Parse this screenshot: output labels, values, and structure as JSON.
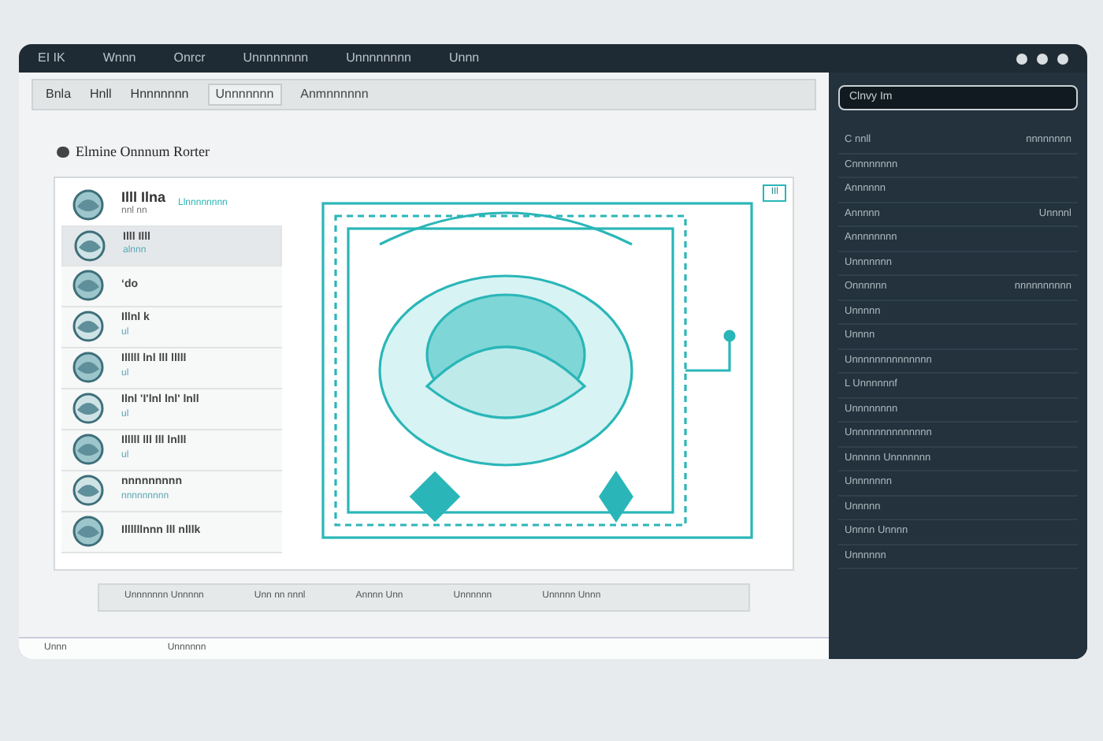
{
  "menu_bar": {
    "items": [
      "EI IK",
      "Wnnn",
      "Onrcr",
      "Unnnnnnnn",
      "Unnnnnnnn",
      "Unnn"
    ]
  },
  "toolbar": {
    "items": [
      "Bnla",
      "Hnll",
      "Hnnnnnnn"
    ],
    "field": "Unnnnnnn",
    "path": "Anmnnnnnn"
  },
  "heading": "Elmine Onnnum Rorter",
  "document": {
    "title": "Illl Ilna",
    "subtitle": "nnl nn",
    "link": "Llnnnnnnnn",
    "badge": "IIl"
  },
  "list": [
    {
      "title": "Illl Illl",
      "sub": "alnnn",
      "selected": true
    },
    {
      "title": "ʻdo",
      "selected": false
    },
    {
      "title": "Illnl k",
      "sub": "ul",
      "selected": false
    },
    {
      "title": "Illlll lnl lll lllll",
      "sub": "ul",
      "selected": false
    },
    {
      "title": "Ilnl 'I'lnl lnl' lnll",
      "sub": "ul",
      "selected": false
    },
    {
      "title": "Illlll lll lll lnlll",
      "sub": "ul",
      "selected": false
    },
    {
      "title": "nnnnnnnnn",
      "sub": "nnnnnnnnn",
      "selected": false
    },
    {
      "title": "Illllllnnn lll nlllk",
      "selected": false
    }
  ],
  "status_bar": [
    "Unnnnnnn Unnnnn",
    "Unn nn nnnl",
    "Annnn Unn",
    "Unnnnnn",
    "Unnnnn Unnn"
  ],
  "bottom_bar": [
    "Unnn",
    "Unnnnnn"
  ],
  "side_panel": {
    "search": "Clnvy Im",
    "rows": [
      {
        "label": "C nnll",
        "value": "nnnnnnnn"
      },
      {
        "label": "Cnnnnnnnn"
      },
      {
        "label": "Annnnnn"
      },
      {
        "label": "Annnnn",
        "value": "Unnnnl"
      },
      {
        "label": "Annnnnnnn"
      },
      {
        "label": "Unnnnnnn"
      },
      {
        "label": "Onnnnnn",
        "value": "nnnnnnnnnn"
      },
      {
        "label": "Unnnnn"
      },
      {
        "label": "Unnnn"
      },
      {
        "label": "Unnnnnnnnnnnnnn"
      },
      {
        "label": "L Unnnnnnf"
      },
      {
        "label": "Unnnnnnnn"
      },
      {
        "label": "Unnnnnnnnnnnnnn"
      },
      {
        "label": "Unnnnn Unnnnnnn"
      },
      {
        "label": "Unnnnnnn"
      },
      {
        "label": "Unnnnn"
      },
      {
        "label": "Unnnn Unnnn"
      },
      {
        "label": "Unnnnnn"
      }
    ]
  }
}
